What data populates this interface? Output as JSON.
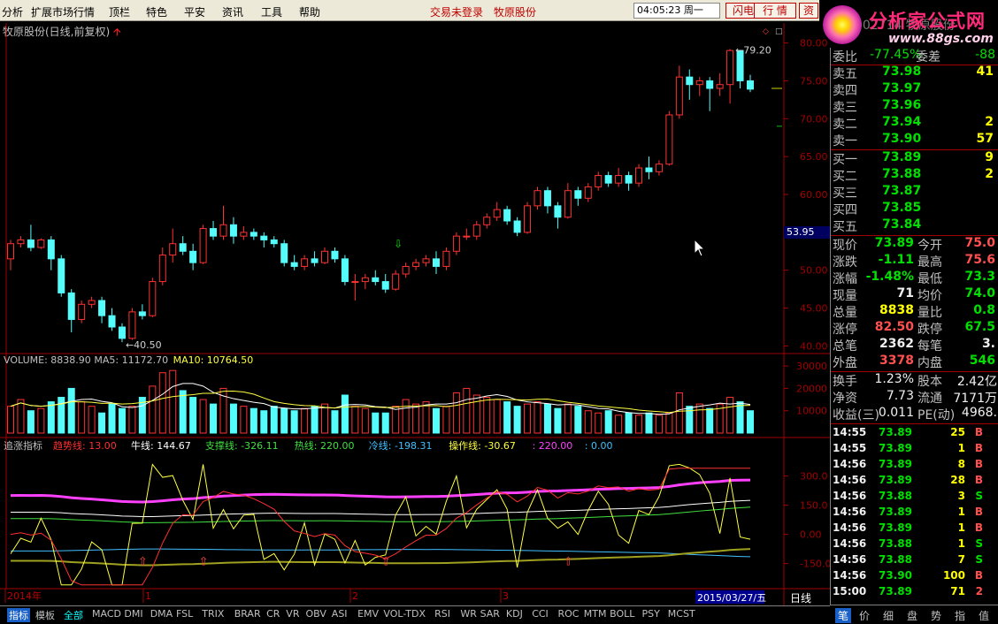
{
  "menu": {
    "items": [
      "分析",
      "扩展市场行情",
      "顶栏",
      "特色",
      "平安",
      "资讯",
      "工具",
      "帮助"
    ],
    "warn": "交易未登录",
    "stock": "牧原股份",
    "time": "04:05:23 周一",
    "btn1": "闪电手",
    "btn2": "行 情",
    "btn3": "资"
  },
  "logo": {
    "title": "分析家公式网",
    "url": "www.88gs.com",
    "bg": "002714 牧原股份"
  },
  "chart_title": "牧原股份(日线,前复权)",
  "chart_data": {
    "type": "candlestick",
    "y_axis": [
      "80.00",
      "75.00",
      "70.00",
      "65.00",
      "60.00",
      "55.00",
      "50.00",
      "45.00",
      "40.00"
    ],
    "ylim": [
      39,
      81
    ],
    "current_price_label": "53.95",
    "high_label": "79.20",
    "low_label": "40.50",
    "candles": [
      [
        51.5,
        53.5,
        50.0,
        54.0
      ],
      [
        53.5,
        54.0,
        53.0,
        54.5
      ],
      [
        54.0,
        53.0,
        52.5,
        56.0
      ],
      [
        53.0,
        54.0,
        52.8,
        54.2
      ],
      [
        54.0,
        51.5,
        50.0,
        54.5
      ],
      [
        51.5,
        47.0,
        46.5,
        52.0
      ],
      [
        47.0,
        43.5,
        41.8,
        47.5
      ],
      [
        43.5,
        45.5,
        43.0,
        46.0
      ],
      [
        45.5,
        46.0,
        45.0,
        46.5
      ],
      [
        46.0,
        44.0,
        43.0,
        46.5
      ],
      [
        44.0,
        42.5,
        42.0,
        45.0
      ],
      [
        42.5,
        41.0,
        40.5,
        43.0
      ],
      [
        41.0,
        44.5,
        40.8,
        45.0
      ],
      [
        44.5,
        44.0,
        43.5,
        45.5
      ],
      [
        44.0,
        48.5,
        43.8,
        49.0
      ],
      [
        48.5,
        52.0,
        48.0,
        53.0
      ],
      [
        52.0,
        53.5,
        51.0,
        55.5
      ],
      [
        53.5,
        52.5,
        52.0,
        54.5
      ],
      [
        52.5,
        51.0,
        50.0,
        53.5
      ],
      [
        51.0,
        55.5,
        50.8,
        56.0
      ],
      [
        55.5,
        54.5,
        54.0,
        56.5
      ],
      [
        54.5,
        56.0,
        54.0,
        58.5
      ],
      [
        56.0,
        54.5,
        53.5,
        57.0
      ],
      [
        54.5,
        55.0,
        54.0,
        55.8
      ],
      [
        55.0,
        54.5,
        54.0,
        55.5
      ],
      [
        54.5,
        54.0,
        53.0,
        55.0
      ],
      [
        54.0,
        53.5,
        53.0,
        54.5
      ],
      [
        53.5,
        51.0,
        50.5,
        54.0
      ],
      [
        51.0,
        50.5,
        50.0,
        52.0
      ],
      [
        50.5,
        51.5,
        50.0,
        52.0
      ],
      [
        51.5,
        51.0,
        50.5,
        52.5
      ],
      [
        51.0,
        52.5,
        50.8,
        53.0
      ],
      [
        52.5,
        51.5,
        51.0,
        53.0
      ],
      [
        51.5,
        48.5,
        48.0,
        52.0
      ],
      [
        48.5,
        48.5,
        46.0,
        49.5
      ],
      [
        48.5,
        49.0,
        47.5,
        49.5
      ],
      [
        49.0,
        48.5,
        48.0,
        50.0
      ],
      [
        48.5,
        47.5,
        47.0,
        49.5
      ],
      [
        47.5,
        49.5,
        47.3,
        50.0
      ],
      [
        49.5,
        50.5,
        49.0,
        51.0
      ],
      [
        50.5,
        51.0,
        50.0,
        51.5
      ],
      [
        51.0,
        51.5,
        50.5,
        52.0
      ],
      [
        51.5,
        50.5,
        49.5,
        52.5
      ],
      [
        50.5,
        52.5,
        50.0,
        53.0
      ],
      [
        52.5,
        54.5,
        52.0,
        55.0
      ],
      [
        54.5,
        54.5,
        54.0,
        55.5
      ],
      [
        54.5,
        56.0,
        54.0,
        56.5
      ],
      [
        56.0,
        57.0,
        55.5,
        57.5
      ],
      [
        57.0,
        58.0,
        56.5,
        59.0
      ],
      [
        58.0,
        56.5,
        56.0,
        58.5
      ],
      [
        56.5,
        55.0,
        54.5,
        57.0
      ],
      [
        55.0,
        58.5,
        54.8,
        59.0
      ],
      [
        58.5,
        60.5,
        58.0,
        61.0
      ],
      [
        60.5,
        58.5,
        57.5,
        61.0
      ],
      [
        58.5,
        57.0,
        55.5,
        59.0
      ],
      [
        57.0,
        60.5,
        56.8,
        61.5
      ],
      [
        60.5,
        59.5,
        58.5,
        61.0
      ],
      [
        59.5,
        61.0,
        59.0,
        61.5
      ],
      [
        61.0,
        62.5,
        60.5,
        63.0
      ],
      [
        62.5,
        61.5,
        61.0,
        63.0
      ],
      [
        61.5,
        62.5,
        61.0,
        63.5
      ],
      [
        62.5,
        61.5,
        60.5,
        63.0
      ],
      [
        61.5,
        63.5,
        61.0,
        64.0
      ],
      [
        63.5,
        63.0,
        62.0,
        65.0
      ],
      [
        63.0,
        64.0,
        62.5,
        64.5
      ],
      [
        64.0,
        70.5,
        63.8,
        71.0
      ],
      [
        70.5,
        75.5,
        70.0,
        77.0
      ],
      [
        75.5,
        74.5,
        72.5,
        76.5
      ],
      [
        74.5,
        75.0,
        73.0,
        75.5
      ],
      [
        75.0,
        74.0,
        71.0,
        75.5
      ],
      [
        74.0,
        74.5,
        73.0,
        76.0
      ],
      [
        74.5,
        79.0,
        72.0,
        79.2
      ],
      [
        79.0,
        75.0,
        74.0,
        79.0
      ],
      [
        75.0,
        73.9,
        73.5,
        75.8
      ]
    ],
    "volume_header": [
      {
        "k": "VOLUME:",
        "v": "8838.90"
      },
      {
        "k": "MA5:",
        "v": "11172.70"
      },
      {
        "k": "MA10:",
        "v": "10764.50"
      }
    ],
    "volume_axis": [
      "30000",
      "20000",
      "10000"
    ],
    "volumes": [
      12000,
      15000,
      10000,
      11000,
      14000,
      16000,
      20000,
      14000,
      12000,
      9000,
      13000,
      11000,
      12000,
      16000,
      21000,
      27000,
      28000,
      19000,
      16000,
      15000,
      13000,
      20000,
      13000,
      12000,
      11000,
      10000,
      12000,
      11000,
      10000,
      11000,
      12000,
      13000,
      10000,
      17000,
      12000,
      11000,
      9000,
      9000,
      12000,
      15000,
      13000,
      14000,
      11000,
      12000,
      18000,
      20000,
      17000,
      16000,
      15000,
      14000,
      12000,
      13000,
      14000,
      13000,
      11000,
      13000,
      12000,
      10000,
      9000,
      10000,
      8000,
      9000,
      8000,
      9000,
      8000,
      9000,
      18000,
      12000,
      13000,
      11000,
      13000,
      16000,
      14000,
      10000
    ],
    "indicator_header": [
      {
        "k": "追涨指标",
        "v": "",
        "c": "#c0c0c0"
      },
      {
        "k": "趋势线:",
        "v": "13.00",
        "c": "#ff3030"
      },
      {
        "k": "牛线:",
        "v": "144.67",
        "c": "#ffffff"
      },
      {
        "k": "支撑线:",
        "v": "-326.11",
        "c": "#40e040"
      },
      {
        "k": "热线:",
        "v": "220.00",
        "c": "#40e040"
      },
      {
        "k": "冷线:",
        "v": "-198.31",
        "c": "#40c0ff"
      },
      {
        "k": "操作线:",
        "v": "-30.67",
        "c": "#ffff40"
      },
      {
        "k": "",
        "v": ": 220.00",
        "c": "#ff40ff"
      },
      {
        "k": "",
        "v": ": 0.00",
        "c": "#40c0ff"
      }
    ],
    "indicator_axis": [
      "300.0",
      "150.0",
      "0.00",
      "-150.0"
    ],
    "x_labels": [
      "2014年",
      "1",
      "2",
      "3"
    ],
    "date_label": "2015/03/27/五"
  },
  "bottom_tabs": [
    "指标",
    "模板",
    "全部",
    "MACD",
    "DMI",
    "DMA",
    "FSL",
    "TRIX",
    "BRAR",
    "CR",
    "VR",
    "OBV",
    "ASI",
    "EMV",
    "VOL-TDX",
    "RSI",
    "WR",
    "SAR",
    "KDJ",
    "CCI",
    "ROC",
    "MTM",
    "BOLL",
    "PSY",
    "MCST"
  ],
  "period_tab": "日线",
  "quote": {
    "ratio": {
      "label": "委比",
      "value": "-77.45%",
      "label2": "委差",
      "value2": "-88"
    },
    "asks": [
      {
        "label": "卖五",
        "price": "73.98",
        "vol": "41"
      },
      {
        "label": "卖四",
        "price": "73.97",
        "vol": ""
      },
      {
        "label": "卖三",
        "price": "73.96",
        "vol": ""
      },
      {
        "label": "卖二",
        "price": "73.94",
        "vol": "2"
      },
      {
        "label": "卖一",
        "price": "73.90",
        "vol": "57"
      }
    ],
    "bids": [
      {
        "label": "买一",
        "price": "73.89",
        "vol": "9"
      },
      {
        "label": "买二",
        "price": "73.88",
        "vol": "2"
      },
      {
        "label": "买三",
        "price": "73.87",
        "vol": ""
      },
      {
        "label": "买四",
        "price": "73.85",
        "vol": ""
      },
      {
        "label": "买五",
        "price": "73.84",
        "vol": ""
      }
    ],
    "stats": [
      {
        "l1": "现价",
        "v1": "73.89",
        "c1": "grn",
        "l2": "今开",
        "v2": "75.0",
        "c2": "red"
      },
      {
        "l1": "涨跌",
        "v1": "-1.11",
        "c1": "grn",
        "l2": "最高",
        "v2": "75.6",
        "c2": "red"
      },
      {
        "l1": "涨幅",
        "v1": "-1.48%",
        "c1": "grn",
        "l2": "最低",
        "v2": "73.3",
        "c2": "grn"
      },
      {
        "l1": "现量",
        "v1": "71",
        "c1": "wht",
        "l2": "均价",
        "v2": "74.0",
        "c2": "grn"
      },
      {
        "l1": "总量",
        "v1": "8838",
        "c1": "yel",
        "l2": "量比",
        "v2": "0.8",
        "c2": "grn"
      },
      {
        "l1": "涨停",
        "v1": "82.50",
        "c1": "red",
        "l2": "跌停",
        "v2": "67.5",
        "c2": "grn"
      },
      {
        "l1": "总笔",
        "v1": "2362",
        "c1": "wht",
        "l2": "每笔",
        "v2": "3.",
        "c2": "wht"
      },
      {
        "l1": "外盘",
        "v1": "3378",
        "c1": "red",
        "l2": "内盘",
        "v2": "546",
        "c2": "grn"
      }
    ],
    "fin": [
      {
        "l1": "换手",
        "v1": "1.23%",
        "l2": "股本",
        "v2": "2.42亿"
      },
      {
        "l1": "净资",
        "v1": "7.73",
        "l2": "流通",
        "v2": "7171万"
      },
      {
        "l1": "收益(三)",
        "v1": "0.011",
        "l2": "PE(动)",
        "v2": "4968."
      }
    ],
    "ticks": [
      {
        "t": "14:55",
        "p": "73.89",
        "v": "25",
        "s": "B"
      },
      {
        "t": "14:55",
        "p": "73.89",
        "v": "1",
        "s": "B"
      },
      {
        "t": "14:56",
        "p": "73.89",
        "v": "8",
        "s": "B"
      },
      {
        "t": "14:56",
        "p": "73.89",
        "v": "28",
        "s": "B"
      },
      {
        "t": "14:56",
        "p": "73.88",
        "v": "3",
        "s": "S"
      },
      {
        "t": "14:56",
        "p": "73.89",
        "v": "1",
        "s": "B"
      },
      {
        "t": "14:56",
        "p": "73.89",
        "v": "1",
        "s": "B"
      },
      {
        "t": "14:56",
        "p": "73.88",
        "v": "1",
        "s": "S"
      },
      {
        "t": "14:56",
        "p": "73.88",
        "v": "7",
        "s": "S"
      },
      {
        "t": "14:56",
        "p": "73.90",
        "v": "100",
        "s": "B"
      },
      {
        "t": "15:00",
        "p": "73.89",
        "v": "71",
        "s": "2"
      }
    ],
    "tabs": [
      "笔",
      "价",
      "细",
      "盘",
      "势",
      "指",
      "值"
    ]
  }
}
